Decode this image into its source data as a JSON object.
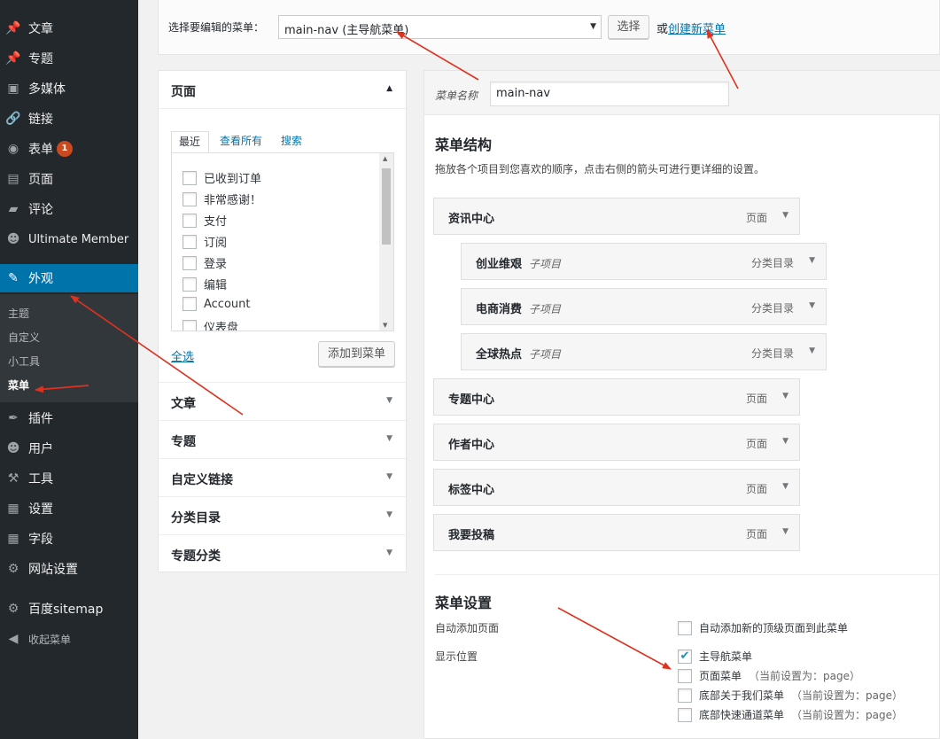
{
  "sidebar": {
    "items": [
      {
        "label": "文章",
        "icon": "pin-icon",
        "glyph": "📌"
      },
      {
        "label": "专题",
        "icon": "pin-icon",
        "glyph": "📌"
      },
      {
        "label": "多媒体",
        "icon": "media-icon",
        "glyph": "▣"
      },
      {
        "label": "链接",
        "icon": "link-icon",
        "glyph": "🔗"
      },
      {
        "label": "表单",
        "icon": "form-icon",
        "glyph": "◉",
        "badge": "1"
      },
      {
        "label": "页面",
        "icon": "page-icon",
        "glyph": "▤"
      },
      {
        "label": "评论",
        "icon": "comment-icon",
        "glyph": "▰"
      },
      {
        "label": "Ultimate Member",
        "icon": "user-icon",
        "glyph": "☻"
      },
      {
        "label": "外观",
        "icon": "brush-icon",
        "glyph": "✎"
      },
      {
        "label": "插件",
        "icon": "plugin-icon",
        "glyph": "✒"
      },
      {
        "label": "用户",
        "icon": "user-icon",
        "glyph": "☻"
      },
      {
        "label": "工具",
        "icon": "wrench-icon",
        "glyph": "⚒"
      },
      {
        "label": "设置",
        "icon": "settings-icon",
        "glyph": "▦"
      },
      {
        "label": "字段",
        "icon": "fields-icon",
        "glyph": "▦"
      },
      {
        "label": "网站设置",
        "icon": "gear-icon",
        "glyph": "⚙"
      },
      {
        "label": "百度sitemap",
        "icon": "gear-icon",
        "glyph": "⚙"
      },
      {
        "label": "收起菜单",
        "icon": "collapse-icon",
        "glyph": "◀"
      }
    ],
    "submenu": [
      "主题",
      "自定义",
      "小工具",
      "菜单"
    ]
  },
  "topbar": {
    "label": "选择要编辑的菜单：",
    "selected": "main-nav (主导航菜单)",
    "select_button": "选择",
    "or_text": "或",
    "create_link": "创建新菜单"
  },
  "left": {
    "page_box_title": "页面",
    "tabs": [
      "最近",
      "查看所有",
      "搜索"
    ],
    "pages": [
      "已收到订单",
      "非常感谢！",
      "支付",
      "订阅",
      "登录",
      "编辑",
      "Account",
      "仪表盘"
    ],
    "select_all": "全选",
    "add_button": "添加到菜单",
    "sections": [
      "文章",
      "专题",
      "自定义链接",
      "分类目录",
      "专题分类"
    ]
  },
  "right": {
    "name_label": "菜单名称",
    "name_value": "main-nav",
    "structure_title": "菜单结构",
    "structure_desc": "拖放各个项目到您喜欢的顺序，点击右侧的箭头可进行更详细的设置。",
    "sub_label": "子项目",
    "items": [
      {
        "title": "资讯中心",
        "type": "页面",
        "child": false
      },
      {
        "title": "创业维艰",
        "type": "分类目录",
        "child": true
      },
      {
        "title": "电商消费",
        "type": "分类目录",
        "child": true
      },
      {
        "title": "全球热点",
        "type": "分类目录",
        "child": true
      },
      {
        "title": "专题中心",
        "type": "页面",
        "child": false
      },
      {
        "title": "作者中心",
        "type": "页面",
        "child": false
      },
      {
        "title": "标签中心",
        "type": "页面",
        "child": false
      },
      {
        "title": "我要投稿",
        "type": "页面",
        "child": false
      }
    ],
    "settings_title": "菜单设置",
    "auto_add_label": "自动添加页面",
    "auto_add_option": "自动添加新的顶级页面到此菜单",
    "location_label": "显示位置",
    "locations": [
      {
        "label": "主导航菜单",
        "note": "",
        "checked": true
      },
      {
        "label": "页面菜单",
        "note": "（当前设置为：page）",
        "checked": false
      },
      {
        "label": "底部关于我们菜单",
        "note": "（当前设置为：page）",
        "checked": false
      },
      {
        "label": "底部快速通道菜单",
        "note": "（当前设置为：page）",
        "checked": false
      }
    ]
  },
  "colors": {
    "sidebar": "#23282d",
    "active": "#0073aa",
    "badge": "#ca4a1f",
    "annotation": "#e0311f"
  }
}
